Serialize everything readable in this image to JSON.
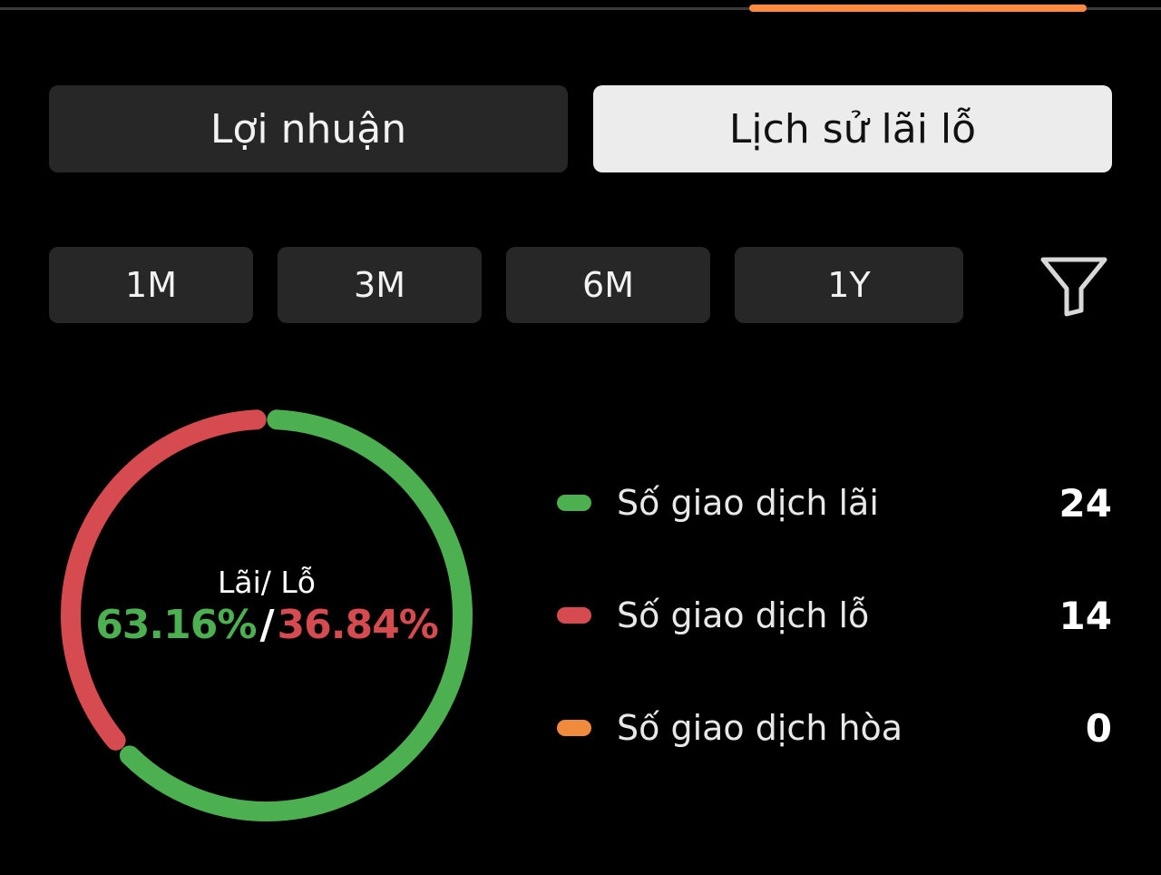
{
  "colors": {
    "win": "#4caf50",
    "loss": "#d64b50",
    "draw": "#f08a3c",
    "accent": "#ff8a3d"
  },
  "tabs": {
    "profit_label": "Lợi nhuận",
    "history_label": "Lịch sử lãi lỗ",
    "active": "history"
  },
  "periods": [
    "1M",
    "3M",
    "6M",
    "1Y"
  ],
  "filter": {
    "icon": "filter-funnel-icon"
  },
  "summary": {
    "title": "Lãi/ Lỗ",
    "win_pct": "63.16%",
    "separator": "/",
    "loss_pct": "36.84%",
    "win_fraction": 0.6316,
    "loss_fraction": 0.3684
  },
  "legend": [
    {
      "label": "Số giao dịch lãi",
      "value": "24",
      "color": "#4caf50"
    },
    {
      "label": "Số giao dịch lỗ",
      "value": "14",
      "color": "#d64b50"
    },
    {
      "label": "Số giao dịch hòa",
      "value": "0",
      "color": "#f08a3c"
    }
  ]
}
